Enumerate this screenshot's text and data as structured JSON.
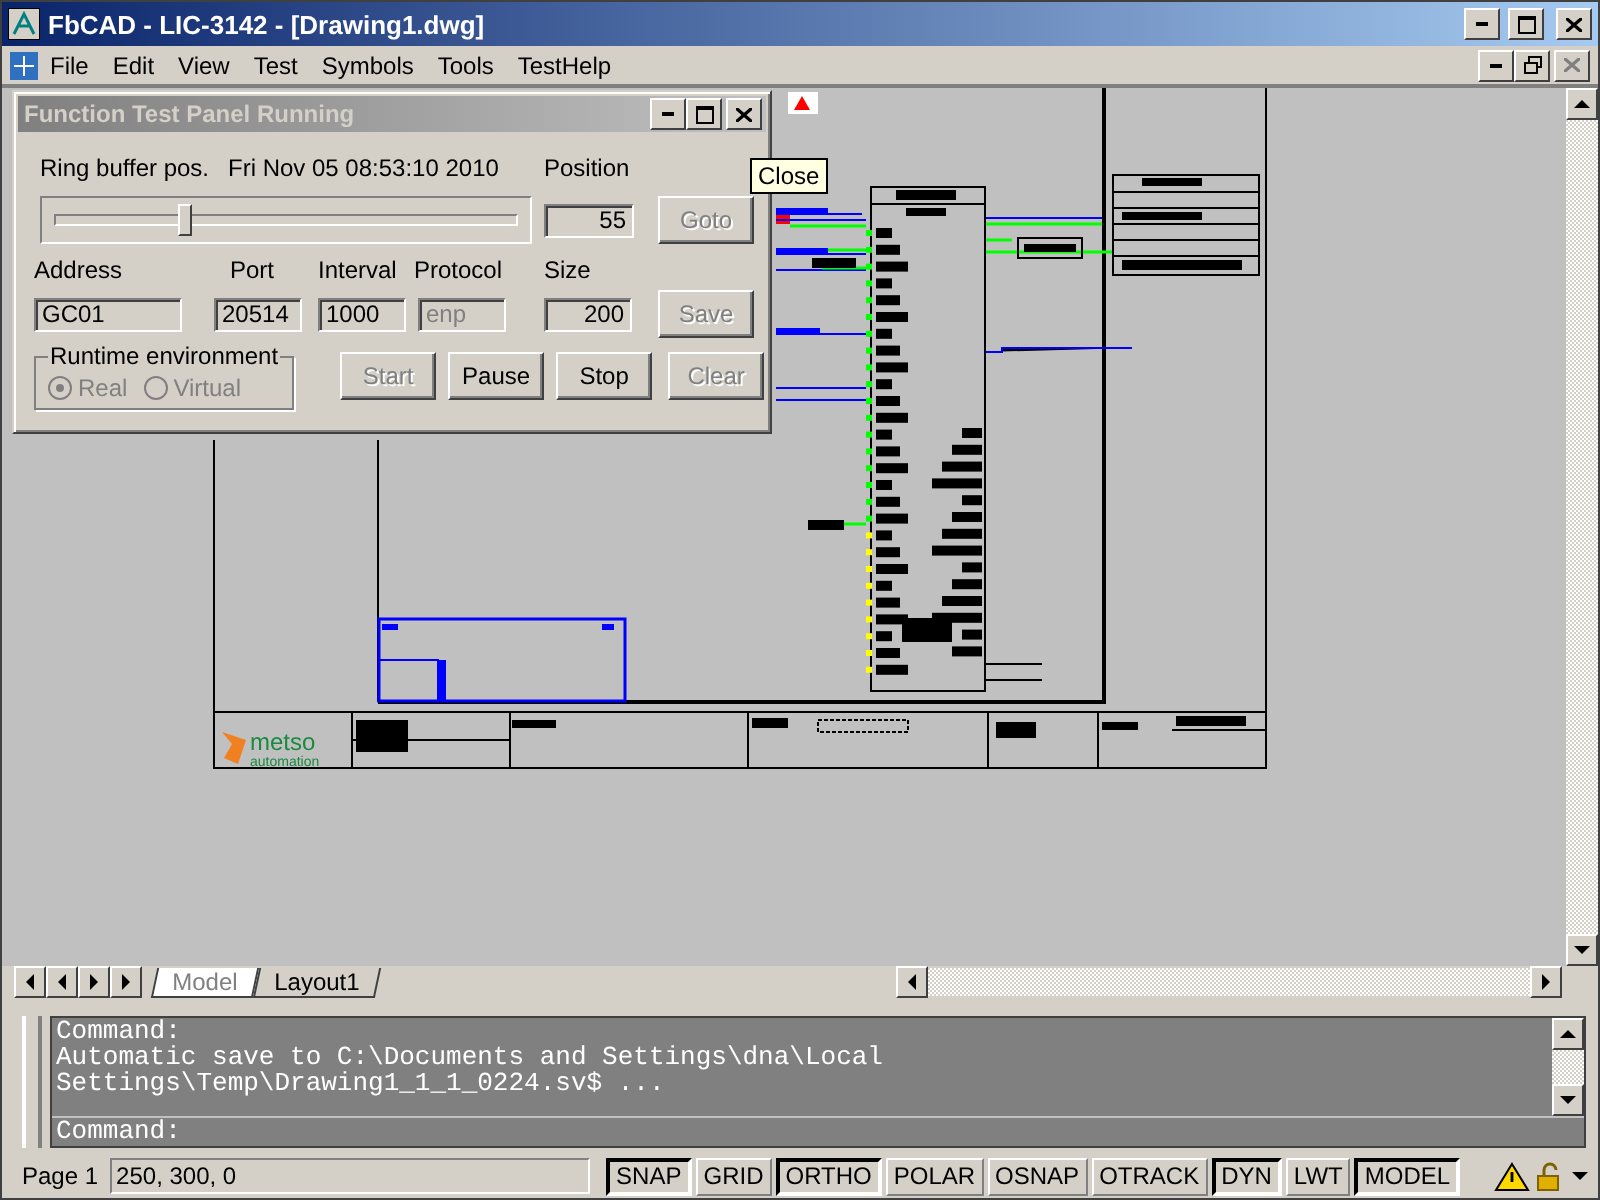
{
  "window": {
    "title": "FbCAD - LIC-3142 - [Drawing1.dwg]"
  },
  "menu": [
    {
      "label": "File"
    },
    {
      "label": "Edit"
    },
    {
      "label": "View"
    },
    {
      "label": "Test"
    },
    {
      "label": "Symbols"
    },
    {
      "label": "Tools"
    },
    {
      "label": "TestHelp"
    }
  ],
  "panel": {
    "title": "Function Test Panel Running",
    "ring_buffer_label": "Ring buffer pos.",
    "timestamp": "Fri Nov 05 08:53:10 2010",
    "position_label": "Position",
    "slider": {
      "level": 0.28
    },
    "position_value": "55",
    "fields": [
      {
        "label": "Address",
        "value": "GC01",
        "disabled": false
      },
      {
        "label": "Port",
        "value": "20514",
        "disabled": false
      },
      {
        "label": "Interval",
        "value": "1000",
        "disabled": false
      },
      {
        "label": "Protocol",
        "value": "enp",
        "disabled": true
      },
      {
        "label": "Size",
        "value": "200",
        "disabled": false
      }
    ],
    "environment": {
      "legend": "Runtime environment",
      "options": [
        {
          "label": "Real",
          "selected": true,
          "disabled": true
        },
        {
          "label": "Virtual",
          "selected": false,
          "disabled": true
        }
      ]
    },
    "buttons": [
      {
        "label": "Goto",
        "disabled": true
      },
      {
        "label": "Save",
        "disabled": true
      },
      {
        "label": "Start",
        "disabled": true
      },
      {
        "label": "Pause",
        "disabled": false
      },
      {
        "label": "Stop",
        "disabled": false
      },
      {
        "label": "Clear",
        "disabled": true
      }
    ]
  },
  "tooltip": {
    "text": "Close"
  },
  "drawing": {
    "logo": {
      "name": "metso",
      "tagline": "automation"
    }
  },
  "tabs": [
    {
      "label": "Model",
      "selected": true
    },
    {
      "label": "Layout1",
      "selected": false
    }
  ],
  "command": {
    "lines": [
      "Command:",
      "Automatic save to C:\\Documents and Settings\\dna\\Local",
      "Settings\\Temp\\Drawing1_1_1_0224.sv$ ..."
    ],
    "prompt": "Command:"
  },
  "status": {
    "page": "Page 1",
    "coords": "250, 300, 0",
    "toggles": [
      {
        "label": "SNAP",
        "on": true
      },
      {
        "label": "GRID",
        "on": false
      },
      {
        "label": "ORTHO",
        "on": true
      },
      {
        "label": "POLAR",
        "on": false
      },
      {
        "label": "OSNAP",
        "on": false
      },
      {
        "label": "OTRACK",
        "on": false
      },
      {
        "label": "DYN",
        "on": true
      },
      {
        "label": "LWT",
        "on": false
      },
      {
        "label": "MODEL",
        "on": true
      }
    ]
  }
}
